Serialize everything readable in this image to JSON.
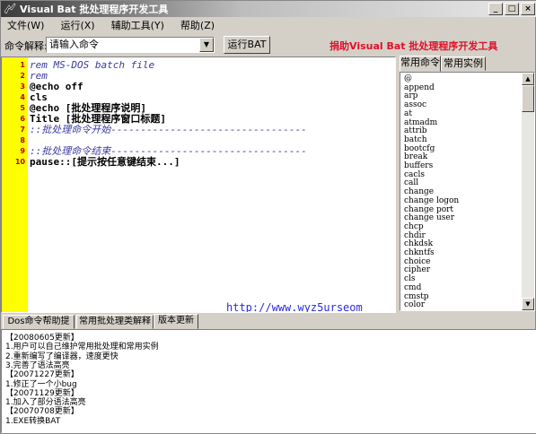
{
  "window": {
    "title": "Visual Bat 批处理程序开发工具",
    "buttons": {
      "minimize": "_",
      "maximize": "□",
      "close": "×"
    }
  },
  "menu": [
    {
      "label": "文件(W)"
    },
    {
      "label": "运行(X)"
    },
    {
      "label": "辅助工具(Y)"
    },
    {
      "label": "帮助(Z)"
    }
  ],
  "toolbar": {
    "cmd_label": "命令解释:",
    "cmd_select_value": "请输入命令",
    "run_button": "运行BAT",
    "donate_text": "捐助Visual Bat 批处理程序开发工具"
  },
  "editor": {
    "lines": [
      {
        "num": "1",
        "text": "rem MS-DOS batch file",
        "style": "comment"
      },
      {
        "num": "2",
        "text": "rem",
        "style": "comment"
      },
      {
        "num": "3",
        "text": "@echo off",
        "style": "kw"
      },
      {
        "num": "4",
        "text": "cls",
        "style": "kw"
      },
      {
        "num": "5",
        "text": "@echo [批处理程序说明]",
        "style": "kw"
      },
      {
        "num": "6",
        "text": "Title [批处理程序窗口标题]",
        "style": "kw"
      },
      {
        "num": "7",
        "text": "::批处理命令开始---------------------------------",
        "style": "comment"
      },
      {
        "num": "8",
        "text": "",
        "style": "kw"
      },
      {
        "num": "9",
        "text": "::批处理命令结束---------------------------------",
        "style": "comment"
      },
      {
        "num": "10",
        "text": "pause::[提示按任意键结束...]",
        "style": "kw"
      }
    ],
    "watermark_url": "http://www.wyz5urseom"
  },
  "right_panel": {
    "tabs": [
      "常用命令",
      "常用实例"
    ],
    "active_tab": 0,
    "commands": [
      "@",
      "append",
      "arp",
      "assoc",
      "at",
      "atmadm",
      "attrib",
      "batch",
      "bootcfg",
      "break",
      "buffers",
      "cacls",
      "call",
      "change",
      "change logon",
      "change port",
      "change user",
      "chcp",
      "chdir",
      "chkdsk",
      "chkntfs",
      "choice",
      "cipher",
      "cls",
      "cmd",
      "cmstp",
      "color"
    ]
  },
  "bottom_tabs": {
    "tabs": [
      "Dos命令帮助提示",
      "常用批处理类解释",
      "版本更新"
    ],
    "active_tab": 2
  },
  "version_notes": [
    "【20080605更新】",
    "1.用户可以自己维护常用批处理和常用实例",
    "2.重新编写了编译器，速度更快",
    "3.完善了语法高亮",
    "【20071227更新】",
    "1.修正了一个小bug",
    "【20071129更新】",
    "1.加入了部分语法高亮",
    "【20070708更新】",
    "1.EXE转换BAT"
  ],
  "colors": {
    "gutter": "#ffff00",
    "line_number": "#c00000",
    "comment": "#3a3aa0",
    "donate": "#e0102a",
    "url": "#2a2ae0"
  }
}
